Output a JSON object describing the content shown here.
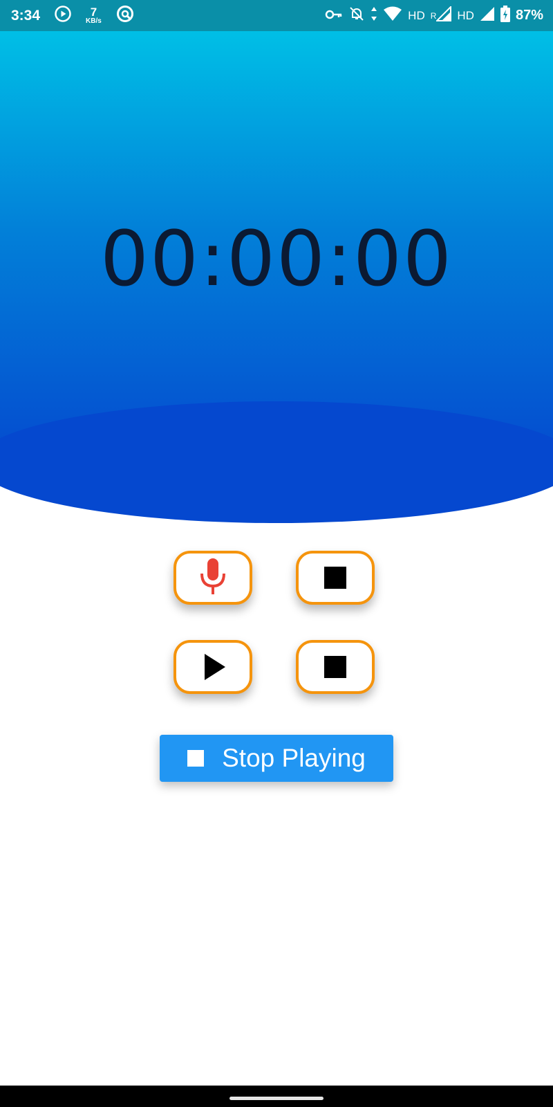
{
  "status_bar": {
    "time": "3:34",
    "net_speed_value": "7",
    "net_speed_unit": "KB/s",
    "hd1": "HD",
    "roaming": "R",
    "hd2": "HD",
    "battery": "87%",
    "icons": [
      "play-circle-icon",
      "data-saver-icon",
      "vpn-key-icon",
      "notifications-off-icon",
      "wifi-icon",
      "signal-icon",
      "battery-charging-icon"
    ]
  },
  "timer": {
    "display": "00:00:00"
  },
  "controls": {
    "record_icon": "mic-icon",
    "stop_record_icon": "stop-icon",
    "play_icon": "play-icon",
    "stop_play_icon": "stop-icon"
  },
  "stop_playing_button": {
    "label": "Stop Playing",
    "icon": "stop-icon"
  },
  "colors": {
    "status_bar": "#0a8fa8",
    "gradient_top": "#00bfe6",
    "gradient_bottom": "#0548cf",
    "button_border": "#f5940d",
    "mic": "#e94235",
    "primary_button": "#2196f3"
  }
}
